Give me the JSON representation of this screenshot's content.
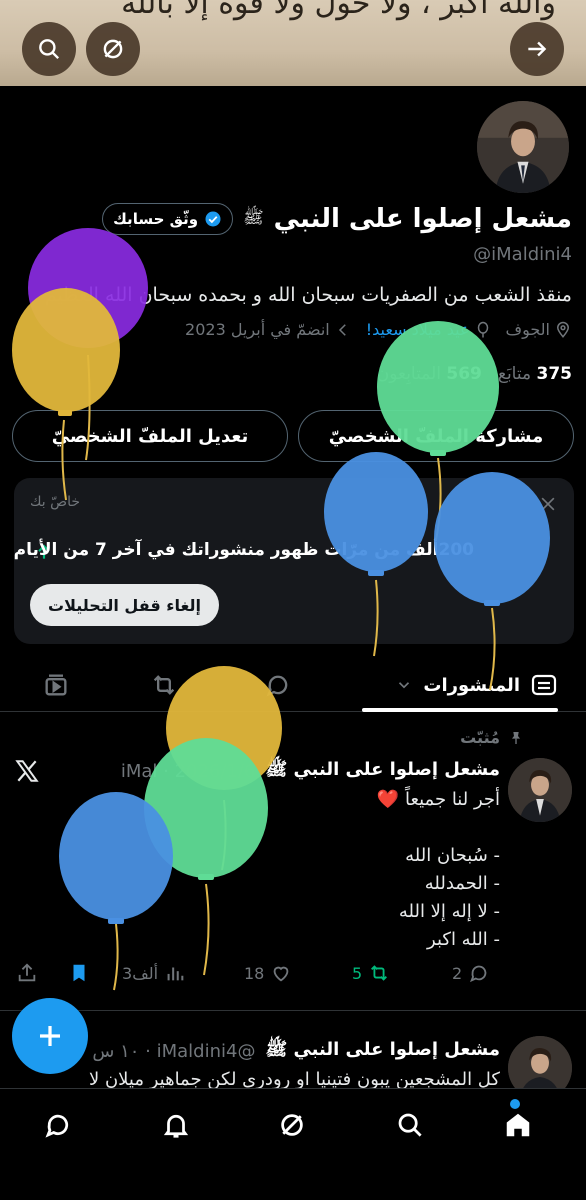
{
  "banner": {
    "calligraphy": "والله أكبر ، ولا حول ولا قوة إلا بالله"
  },
  "profile": {
    "name": "مشعل إصلوا على النبي",
    "pbuh": "ﷺ",
    "verify_label": "وثّق حسابك",
    "handle": "@iMaldini4",
    "bio": "منقذ الشعب من الصفريات سبحان الله و بحمده سبحان الله العظيم",
    "location": "الجوف",
    "birthday": "عيد ميلاد سعيد!",
    "joined": "انضمّ في أبريل 2023",
    "following_count": "375",
    "following_label": "متابَع",
    "followers_count": "569",
    "followers_label": "المتابِعون",
    "edit_button": "تعديل الملفّ الشخصيّ",
    "share_button": "مشاركة الملفّ الشخصيّ"
  },
  "private_card": {
    "label": "خاصّ بك",
    "text": "200ألف من مرّات ظهور منشوراتك في آخر 7 من الأيام",
    "button": "إلغاء قفل التحليلات"
  },
  "tabs": {
    "posts": "المنشورات"
  },
  "pinned_label": "مُثبّت",
  "tweet1": {
    "name": "مشعل إصلوا على النبي ﷺ",
    "date": "2026/1/6 · iMal",
    "line1": "أجر لنا جميعاً ❤️",
    "line2": "- سُبحان الله",
    "line3": "- الحمدلله",
    "line4": "- لا إله إلا الله",
    "line5": "- الله اكبر",
    "replies": "2",
    "reposts": "5",
    "likes": "18",
    "views": "3ألف"
  },
  "tweet2": {
    "name": "مشعل إصلوا على النبي ﷺ",
    "meta": "@iMaldini4 · ١٠ س",
    "text": "كل المشجعين يبون فتينيا او رودري لكن جماهير ميلان لا"
  },
  "colors": {
    "accent": "#1d9bf0",
    "repost_green": "#00ba7c",
    "like_red": "#f91880"
  },
  "icons": [
    "search-icon",
    "no-sign-icon",
    "arrow-right-icon",
    "home-icon",
    "search-icon",
    "grok-icon",
    "bell-icon",
    "chat-icon"
  ]
}
